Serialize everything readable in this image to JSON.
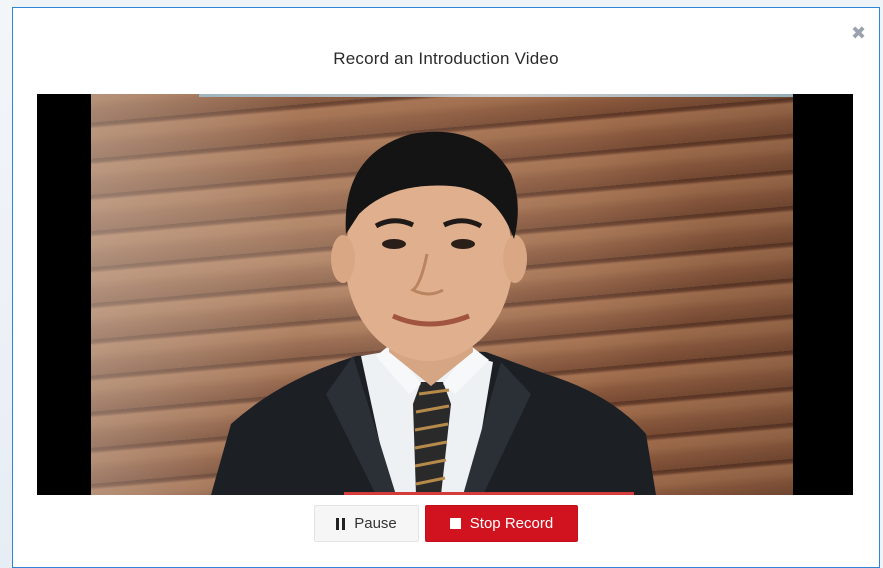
{
  "modal": {
    "title": "Record an Introduction Video",
    "close_icon": "close-icon"
  },
  "controls": {
    "pause_label": "Pause",
    "pause_icon": "pause-icon",
    "stop_label": "Stop Record",
    "stop_icon": "stop-icon"
  },
  "colors": {
    "accent_border": "#2f84d6",
    "stop_button": "#d0131f",
    "recording_bar": "#d63b3b"
  }
}
